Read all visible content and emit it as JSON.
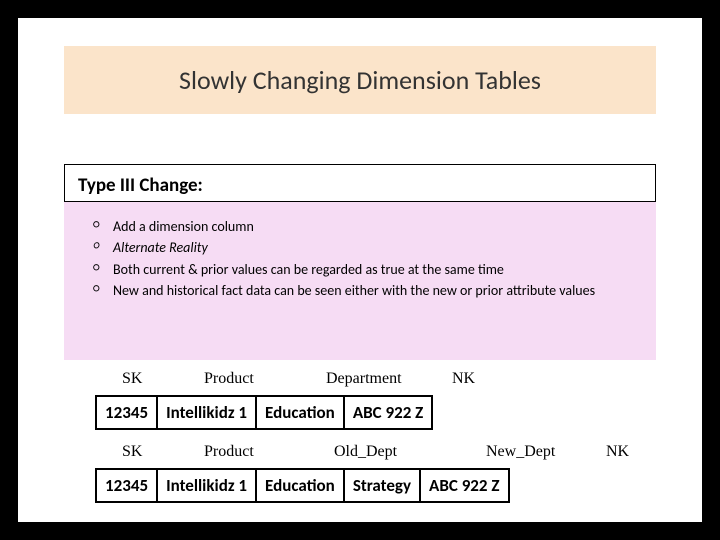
{
  "title": "Slowly Changing Dimension Tables",
  "section_heading": "Type III Change:",
  "bullets": {
    "b0": "Add a dimension column",
    "b1": "Alternate Reality",
    "b2": "Both current & prior values can be regarded as true at the same time",
    "b3": "New and historical fact data can be seen either with the new or prior attribute values"
  },
  "table1": {
    "headers": {
      "h0": "SK",
      "h1": "Product",
      "h2": "Department",
      "h3": "NK"
    },
    "row": {
      "c0": "12345",
      "c1": "Intellikidz 1",
      "c2": "Education",
      "c3": "ABC 922 Z"
    }
  },
  "table2": {
    "headers": {
      "h0": "SK",
      "h1": "Product",
      "h2": "Old_Dept",
      "h3": "New_Dept",
      "h4": "NK"
    },
    "row": {
      "c0": "12345",
      "c1": "Intellikidz 1",
      "c2": "Education",
      "c3": "Strategy",
      "c4": "ABC 922 Z"
    }
  }
}
